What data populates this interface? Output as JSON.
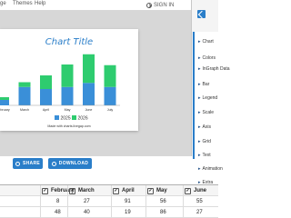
{
  "menu": {
    "items": [
      "ge",
      "Themes",
      "Help"
    ],
    "sign_in": "SIGN IN"
  },
  "chart_data": {
    "type": "bar",
    "title": "Chart Title",
    "categories": [
      "February",
      "March",
      "April",
      "May",
      "June",
      "July"
    ],
    "series": [
      {
        "name": "2025",
        "color": "#3a8fd8",
        "values": [
          8,
          27,
          24,
          27,
          33,
          27
        ]
      },
      {
        "name": "2026",
        "color": "#2ecc6f",
        "values": [
          4,
          7,
          20,
          33,
          42,
          32
        ]
      }
    ],
    "stacked": true,
    "legend_position": "bottom",
    "footer": "Made with charts.livegap.com"
  },
  "buttons": {
    "share": "SHARE",
    "download": "DOWNLOAD"
  },
  "panel": {
    "items": [
      "Chart",
      "Colors",
      "InGraph Data",
      "Bar",
      "Legend",
      "Scale",
      "Axis",
      "Grid",
      "Text",
      "Animation",
      "Extra"
    ]
  },
  "grid": {
    "headers": [
      "February",
      "March",
      "April",
      "May",
      "June"
    ],
    "rows": [
      [
        "8",
        "27",
        "91",
        "56",
        "55"
      ],
      [
        "48",
        "40",
        "19",
        "86",
        "27"
      ]
    ]
  }
}
